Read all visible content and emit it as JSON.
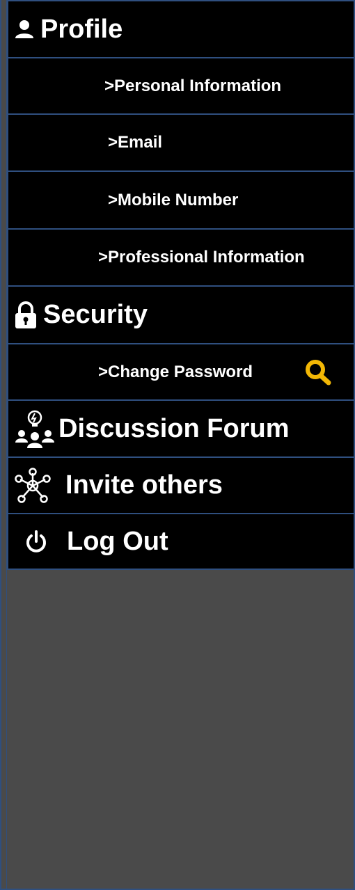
{
  "menu": {
    "profile": {
      "label": "Profile",
      "icon": "person-icon"
    },
    "personal_information": {
      "label": ">Personal Information"
    },
    "email": {
      "label": ">Email"
    },
    "mobile_number": {
      "label": ">Mobile Number"
    },
    "professional_information": {
      "label": ">Professional Information"
    },
    "security": {
      "label": "Security",
      "icon": "lock-icon"
    },
    "change_password": {
      "label": ">Change Password",
      "icon": "search-icon"
    },
    "discussion_forum": {
      "label": "Discussion Forum",
      "icon": "group-idea-icon"
    },
    "invite_others": {
      "label": "Invite others",
      "icon": "network-icon"
    },
    "log_out": {
      "label": "Log Out",
      "icon": "power-icon"
    }
  },
  "colors": {
    "row_bg": "#000000",
    "border": "#2f4f7f",
    "text": "#ffffff",
    "panel_bg": "#4a4a4a",
    "accent": "#f2b705"
  }
}
